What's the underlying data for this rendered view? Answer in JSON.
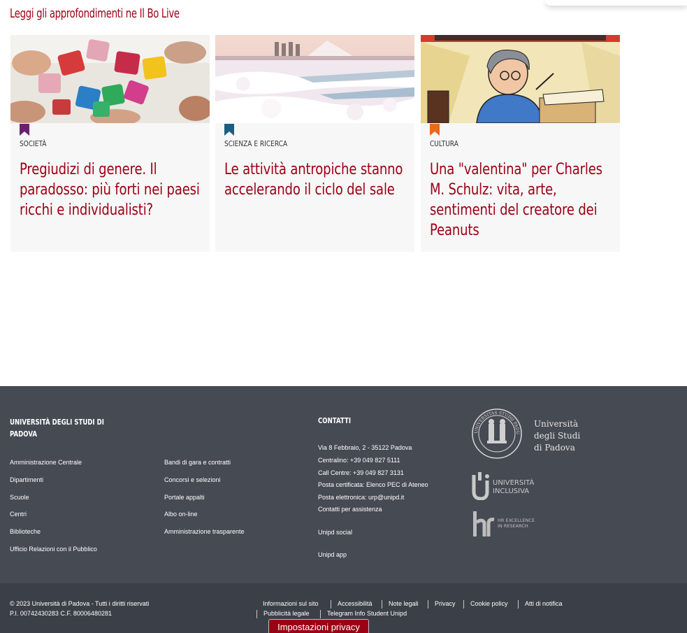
{
  "section_title": "Leggi gli approfondimenti ne Il Bo Live",
  "cards": [
    {
      "category": "Società",
      "category_color": "#6b1f6e",
      "headline": "Pregiudizi di genere. Il paradosso: più forti nei paesi ricchi e individualisti?",
      "image": "puzzle-hands-image"
    },
    {
      "category": "Scienza e ricerca",
      "category_color": "#1a5f82",
      "headline": "Le attività antropiche stanno accelerando il ciclo del sale",
      "image": "salt-flats-image"
    },
    {
      "category": "Cultura",
      "category_color": "#e86a1a",
      "headline": "Una \"valentina\" per Charles M. Schulz: vita, arte, sentimenti del creatore dei Peanuts",
      "image": "schulz-comic-image"
    }
  ],
  "footer": {
    "university": "Università degli Studi di Padova",
    "links_col1": [
      "Amministrazione Centrale",
      "Dipartimenti",
      "Scuole",
      "Centri",
      "Biblioteche",
      "Ufficio Relazioni con il Pubblico"
    ],
    "links_col2": [
      "Bandi di gara e contratti",
      "Concorsi e selezioni",
      "Portale appalti",
      "Albo on-line",
      "Amministrazione trasparente"
    ],
    "contacts_title": "Contatti",
    "address": "Via 8 Febbraio, 2 - 35122 Padova",
    "centralino": "Centralino: +39 049 827 5111",
    "call_centre": "Call Centre: +39 049 827 3131",
    "pec_label": "Posta certificata: ",
    "pec_link": "Elenco PEC di Ateneo",
    "email_label": "Posta elettronica: ",
    "email_link": "urp@unipd.it",
    "assistance": "Contatti per assistenza",
    "social": "Unipd social",
    "app": "Unipd app",
    "logo_text": [
      "Università",
      "degli Studi",
      "di Padova"
    ],
    "seal_text": "UNIVERSITAS STUDII PADUANI",
    "inclusiva_text": [
      "UNIVERSITÀ",
      "INCLUSIVA"
    ],
    "hr_text": [
      "HR EXCELLENCE",
      "IN RESEARCH"
    ],
    "copyright": "© 2023 Università di Padova - Tutti i diritti riservati",
    "piva": "P.I. 00742430283 C.F. 80006480281",
    "legal_row1": [
      "Informazioni sul sito",
      "Accessibilità",
      "Note legali",
      "Privacy",
      "Cookie policy",
      "Atti di notifica"
    ],
    "legal_row2": [
      "Pubblicità legale",
      "Telegram Info Student Unipd"
    ]
  },
  "privacy_button": "Impostazioni privacy"
}
